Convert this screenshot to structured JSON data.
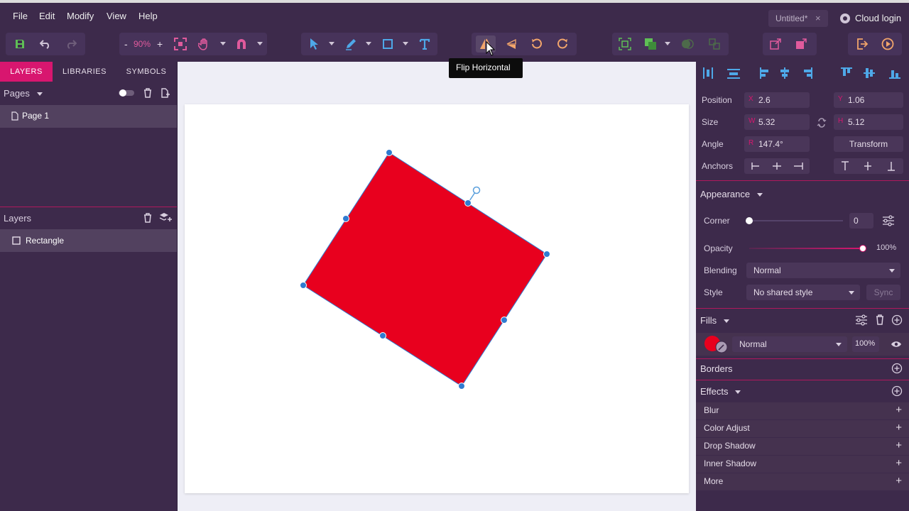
{
  "menu": {
    "items": [
      "File",
      "Edit",
      "Modify",
      "View",
      "Help"
    ]
  },
  "document_tab": {
    "title": "Untitled*",
    "close": "×"
  },
  "cloud_login": {
    "label": "Cloud login"
  },
  "toolbar": {
    "zoom_minus": "-",
    "zoom_value": "90%",
    "zoom_plus": "+",
    "active_tool": "flip-horizontal"
  },
  "tooltip": {
    "text": "Flip Horizontal"
  },
  "left_panel": {
    "tabs": [
      "LAYERS",
      "LIBRARIES",
      "SYMBOLS"
    ],
    "active_tab": "LAYERS",
    "pages_header": "Pages",
    "pages": [
      "Page 1"
    ],
    "layers_header": "Layers",
    "layers": [
      "Rectangle"
    ]
  },
  "selection": {
    "shape": "Rectangle",
    "fill_color": "#e8001e",
    "selection_color": "#2f7bd1"
  },
  "inspector": {
    "position": {
      "label": "Position",
      "x_prefix": "X",
      "x": "2.6",
      "y_prefix": "Y",
      "y": "1.06"
    },
    "size": {
      "label": "Size",
      "w_prefix": "W",
      "w": "5.32",
      "h_prefix": "H",
      "h": "5.12"
    },
    "angle": {
      "label": "Angle",
      "r_prefix": "R",
      "value": "147.4°",
      "transform_button": "Transform"
    },
    "anchors": {
      "label": "Anchors"
    },
    "appearance": {
      "title": "Appearance",
      "corner_label": "Corner",
      "corner_value": "0",
      "opacity_label": "Opacity",
      "opacity_value": "100%",
      "opacity_fraction": 1.0,
      "blending_label": "Blending",
      "blending_value": "Normal",
      "style_label": "Style",
      "style_value": "No shared style",
      "sync_label": "Sync"
    },
    "fills": {
      "title": "Fills",
      "color": "#e8001e",
      "blend": "Normal",
      "opacity": "100%"
    },
    "borders": {
      "title": "Borders"
    },
    "effects": {
      "title": "Effects",
      "items": [
        "Blur",
        "Color Adjust",
        "Drop Shadow",
        "Inner Shadow",
        "More"
      ]
    }
  },
  "colors": {
    "accent": "#d8166f",
    "background": "#3d2a4b",
    "canvas": "#eeeef6"
  }
}
